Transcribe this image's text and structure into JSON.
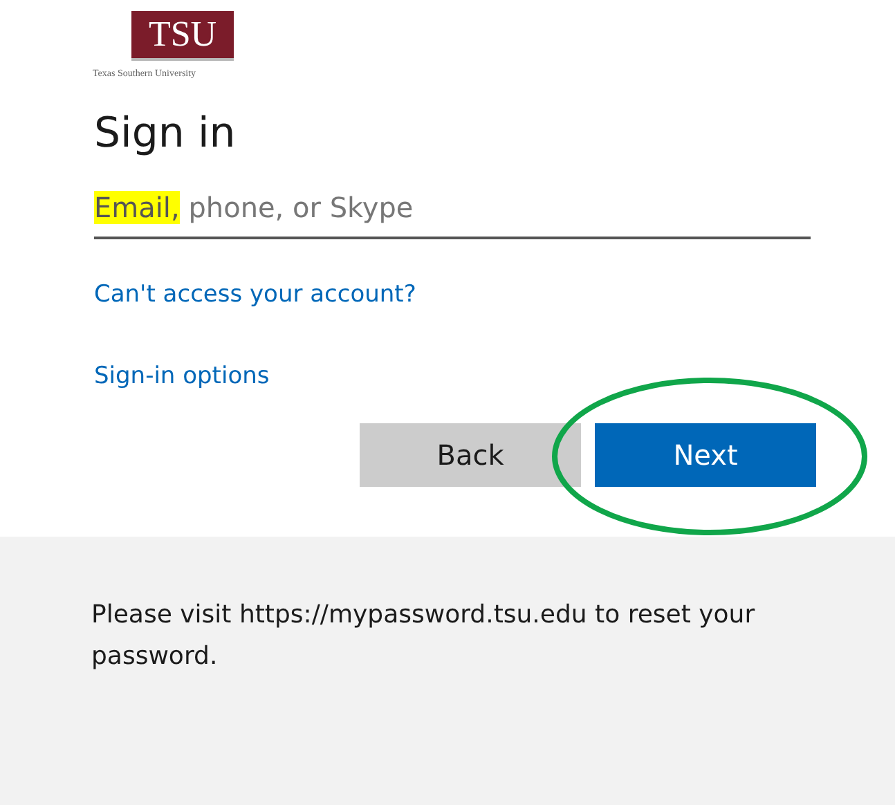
{
  "logo": {
    "mark": "TSU",
    "caption": "Texas Southern University"
  },
  "title": "Sign in",
  "email_field": {
    "placeholder_parts": [
      {
        "text": "Email,",
        "highlighted": true
      },
      {
        "text": " phone, or Skype",
        "highlighted": false
      }
    ]
  },
  "links": [
    "Can't access your account?",
    "Sign-in options"
  ],
  "buttons": [
    {
      "label": "Back",
      "kind": "secondary",
      "circled": false
    },
    {
      "label": "Next",
      "kind": "primary",
      "circled": true
    }
  ],
  "footer": {
    "text": "Please visit https://mypassword.tsu.edu to reset your password."
  }
}
